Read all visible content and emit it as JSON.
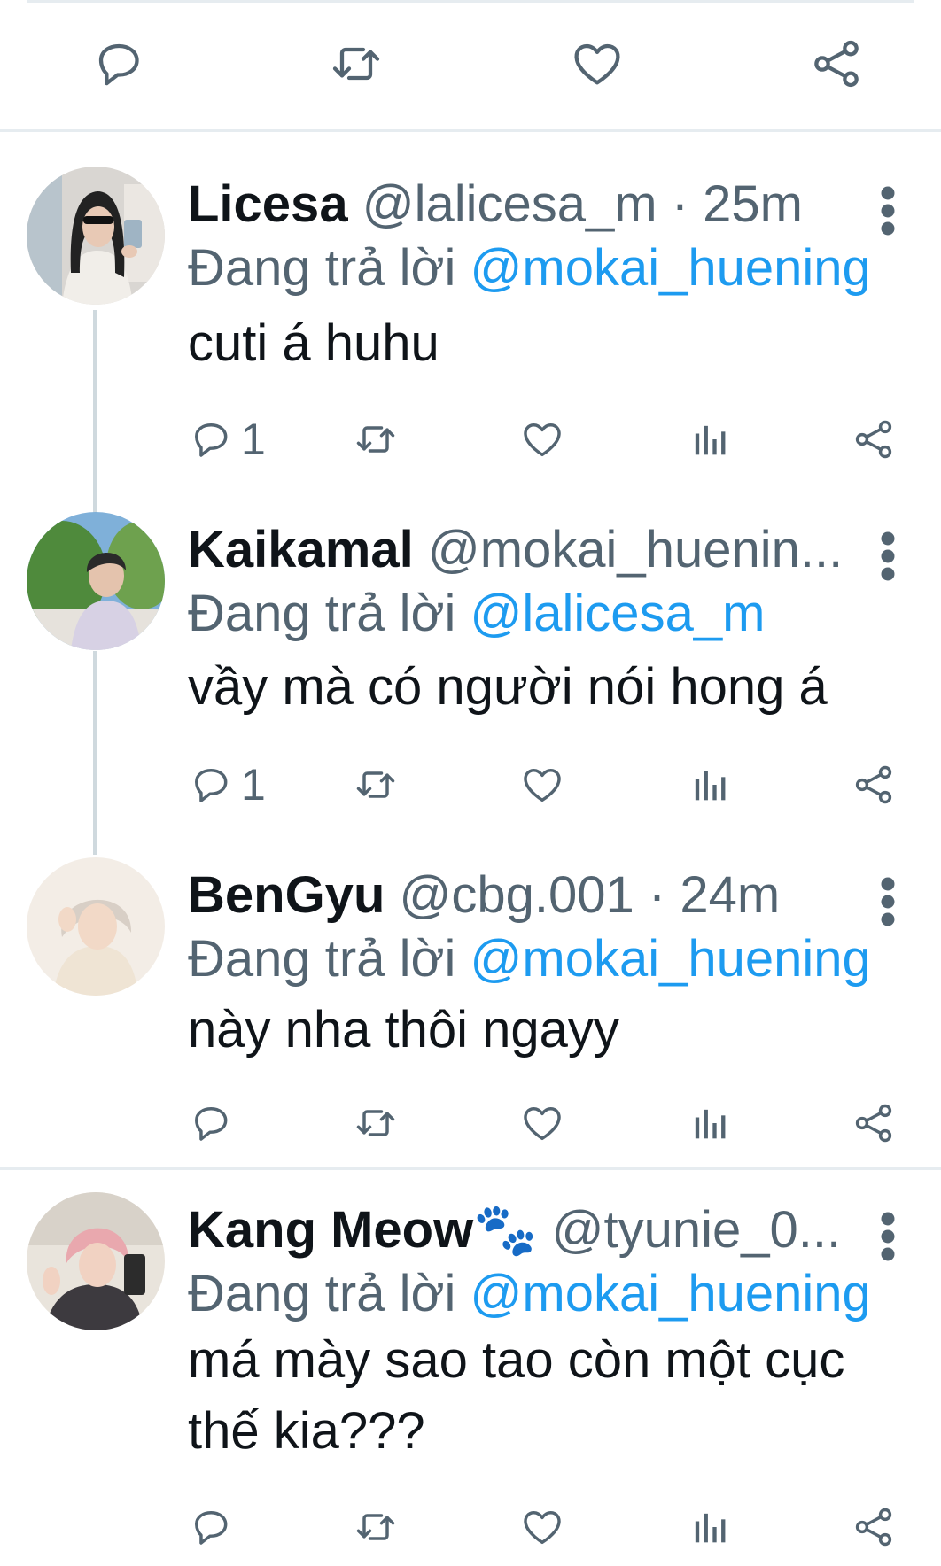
{
  "colors": {
    "text": "#0f1419",
    "secondary": "#536471",
    "accent": "#1d9bf0",
    "divider": "#e6ecf0"
  },
  "top_actions": [
    "reply-icon",
    "retweet-icon",
    "like-icon",
    "share-icon"
  ],
  "replies": [
    {
      "name": "Licesa",
      "handle": "@lalicesa_m",
      "time": "· 25m",
      "replying_label": "Đang trả lời",
      "replying_to": "@mokai_huening",
      "text": "cuti á huhu",
      "reply_count": "1"
    },
    {
      "name": "Kaikamal",
      "handle": "@mokai_huenin...",
      "time": "",
      "replying_label": "Đang trả lời",
      "replying_to": "@lalicesa_m",
      "text": "vầy mà có người nói hong á",
      "reply_count": "1"
    },
    {
      "name": "BenGyu",
      "handle": "@cbg.001",
      "time": "· 24m",
      "replying_label": "Đang trả lời",
      "replying_to": "@mokai_huening",
      "text": "này nha thôi ngayy",
      "reply_count": ""
    },
    {
      "name": "Kang Meow🐾",
      "handle": "@tyunie_0...",
      "time": "",
      "replying_label": "Đang trả lời",
      "replying_to": "@mokai_huening",
      "text": "má mày sao tao còn một cục thế kia???",
      "reply_count": ""
    }
  ]
}
